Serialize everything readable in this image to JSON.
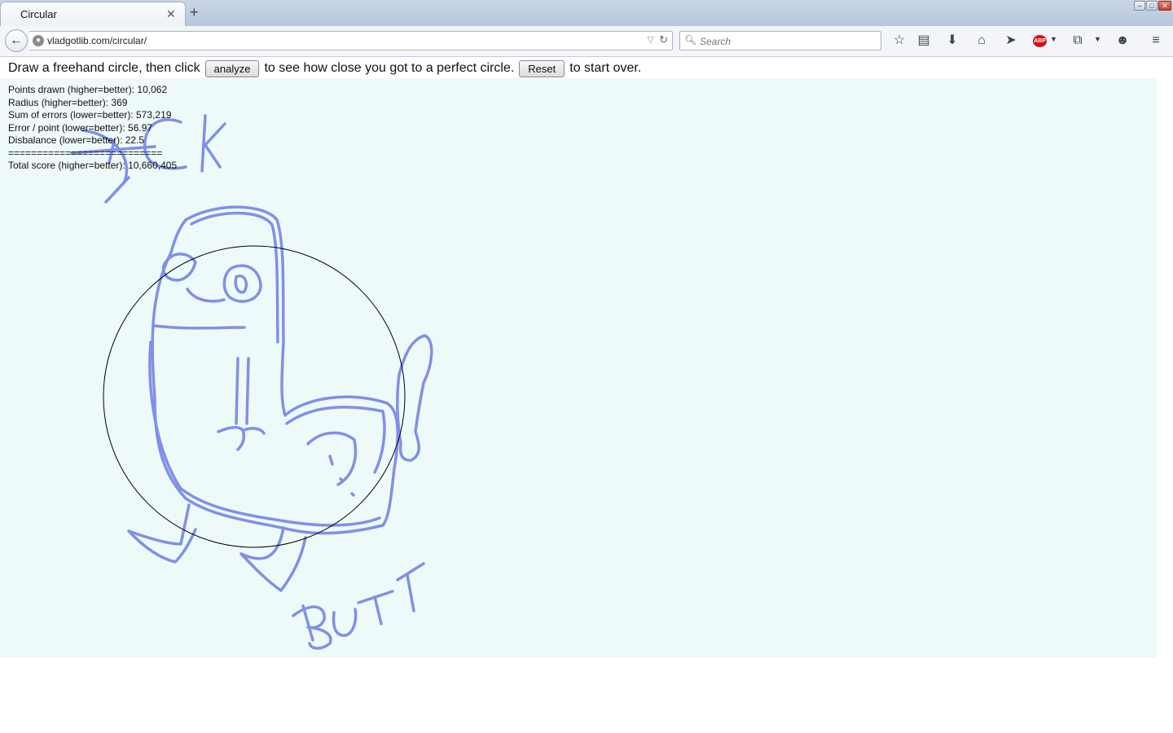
{
  "browser": {
    "tab_title": "Circular",
    "url": "vladgotlib.com/circular/",
    "search_placeholder": "Search",
    "abp_label": "ABP"
  },
  "page": {
    "instruction_part1": "Draw a freehand circle, then click",
    "analyze_label": "analyze",
    "instruction_part2": "to see how close you got to a perfect circle.",
    "reset_label": "Reset",
    "instruction_part3": "to start over."
  },
  "stats": [
    "Points drawn (higher=better): 10,062",
    "Radius (higher=better): 369",
    "Sum of errors (lower=better): 573,219",
    "Error / point (lower=better): 56.97",
    "Disbalance (lower=better): 22.5",
    "===========================",
    "Total score (higher=better): 10,660,405"
  ],
  "drawing": {
    "stroke_color": "#8090e8",
    "circle_color": "#000000",
    "words": [
      "DICK",
      "BUTT"
    ]
  }
}
